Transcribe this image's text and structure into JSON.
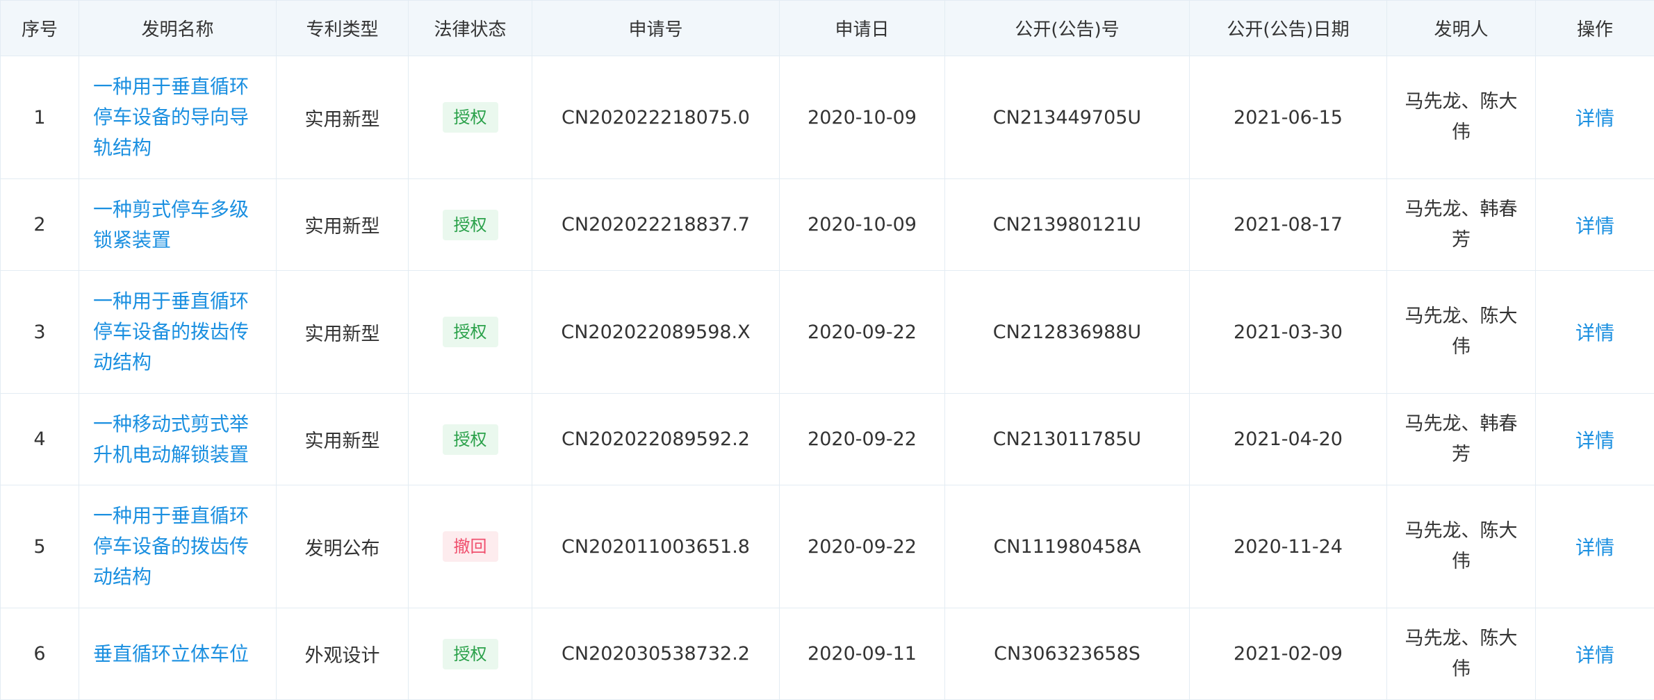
{
  "table": {
    "headers": [
      "序号",
      "发明名称",
      "专利类型",
      "法律状态",
      "申请号",
      "申请日",
      "公开(公告)号",
      "公开(公告)日期",
      "发明人",
      "操作"
    ],
    "rows": [
      {
        "index": "1",
        "title": "一种用于垂直循环停车设备的导向导轨结构",
        "type": "实用新型",
        "status": "授权",
        "app_no": "CN202022218075.0",
        "app_date": "2020-10-09",
        "pub_no": "CN213449705U",
        "pub_date": "2021-06-15",
        "inventors": "马先龙、陈大伟",
        "action": "详情"
      },
      {
        "index": "2",
        "title": "一种剪式停车多级锁紧装置",
        "type": "实用新型",
        "status": "授权",
        "app_no": "CN202022218837.7",
        "app_date": "2020-10-09",
        "pub_no": "CN213980121U",
        "pub_date": "2021-08-17",
        "inventors": "马先龙、韩春芳",
        "action": "详情"
      },
      {
        "index": "3",
        "title": "一种用于垂直循环停车设备的拨齿传动结构",
        "type": "实用新型",
        "status": "授权",
        "app_no": "CN202022089598.X",
        "app_date": "2020-09-22",
        "pub_no": "CN212836988U",
        "pub_date": "2021-03-30",
        "inventors": "马先龙、陈大伟",
        "action": "详情"
      },
      {
        "index": "4",
        "title": "一种移动式剪式举升机电动解锁装置",
        "type": "实用新型",
        "status": "授权",
        "app_no": "CN202022089592.2",
        "app_date": "2020-09-22",
        "pub_no": "CN213011785U",
        "pub_date": "2021-04-20",
        "inventors": "马先龙、韩春芳",
        "action": "详情"
      },
      {
        "index": "5",
        "title": "一种用于垂直循环停车设备的拨齿传动结构",
        "type": "发明公布",
        "status": "撤回",
        "app_no": "CN202011003651.8",
        "app_date": "2020-09-22",
        "pub_no": "CN111980458A",
        "pub_date": "2020-11-24",
        "inventors": "马先龙、陈大伟",
        "action": "详情"
      },
      {
        "index": "6",
        "title": "垂直循环立体车位",
        "type": "外观设计",
        "status": "授权",
        "app_no": "CN202030538732.2",
        "app_date": "2020-09-11",
        "pub_no": "CN306323658S",
        "pub_date": "2021-02-09",
        "inventors": "马先龙、陈大伟",
        "action": "详情"
      }
    ]
  },
  "colors": {
    "link": "#1a8fe0",
    "header_bg": "#f2f7fb",
    "border": "#e3ecf3",
    "granted_bg": "#eaf8ee",
    "granted_text": "#2aa14a",
    "revoked_bg": "#fdecee",
    "revoked_text": "#f0506e"
  }
}
